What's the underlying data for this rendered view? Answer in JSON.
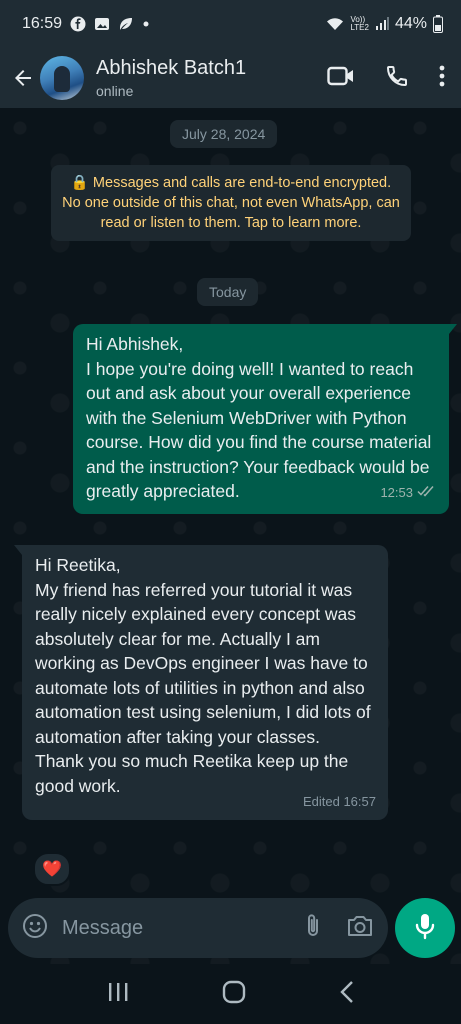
{
  "status_bar": {
    "time": "16:59",
    "battery": "44%",
    "network": "Vo))\nLTE2"
  },
  "header": {
    "contact_name": "Abhishek Batch1",
    "status": "online"
  },
  "chat": {
    "date_pill": "July 28, 2024",
    "encryption_notice": "🔒 Messages and calls are end-to-end encrypted. No one outside of this chat, not even WhatsApp, can read or listen to them. Tap to learn more.",
    "today_pill": "Today",
    "outgoing": {
      "text": "Hi Abhishek,\nI hope you're doing well! I wanted to reach out and ask about your overall experience with the Selenium WebDriver with Python course. How did you find the course material and the instruction? Your feedback would be greatly appreciated.",
      "time": "12:53"
    },
    "incoming": {
      "text": "Hi Reetika,\nMy friend has referred your tutorial it was really nicely explained every concept was absolutely clear for me. Actually I am working as DevOps engineer I was have to automate lots of utilities in python and also automation test using selenium, I did lots of automation after taking your classes.\nThank you so much Reetika keep up the good work.",
      "time": "Edited 16:57",
      "reaction": "❤️"
    }
  },
  "composer": {
    "placeholder": "Message"
  },
  "colors": {
    "outgoing_bubble": "#005c4b",
    "incoming_bubble": "#1f2c34",
    "accent": "#00a884",
    "notice_text": "#ffd279"
  }
}
